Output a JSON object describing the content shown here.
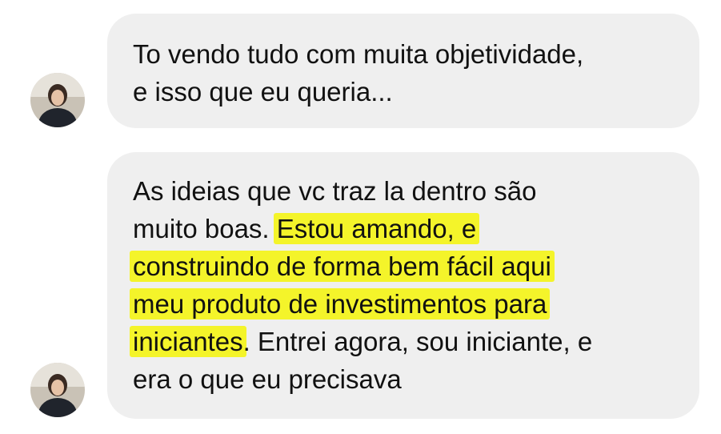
{
  "messages": [
    {
      "lines": [
        "To vendo tudo com muita objetividade,",
        "e isso que eu queria..."
      ]
    },
    {
      "lines": [
        {
          "plain": "As ideias que vc traz la dentro são"
        },
        {
          "plain": "muito boas. ",
          "highlight": "Estou amando, e"
        },
        {
          "highlight": "construindo de forma bem fácil aqui"
        },
        {
          "highlight": "meu produto de investimentos para"
        },
        {
          "highlight": "iniciantes",
          "after": ". Entrei agora, sou iniciante, e"
        },
        {
          "plain": "era o que eu precisava"
        }
      ]
    }
  ],
  "colors": {
    "bubble_background": "#efefef",
    "text": "#111111",
    "highlight": "#f4f42a"
  }
}
